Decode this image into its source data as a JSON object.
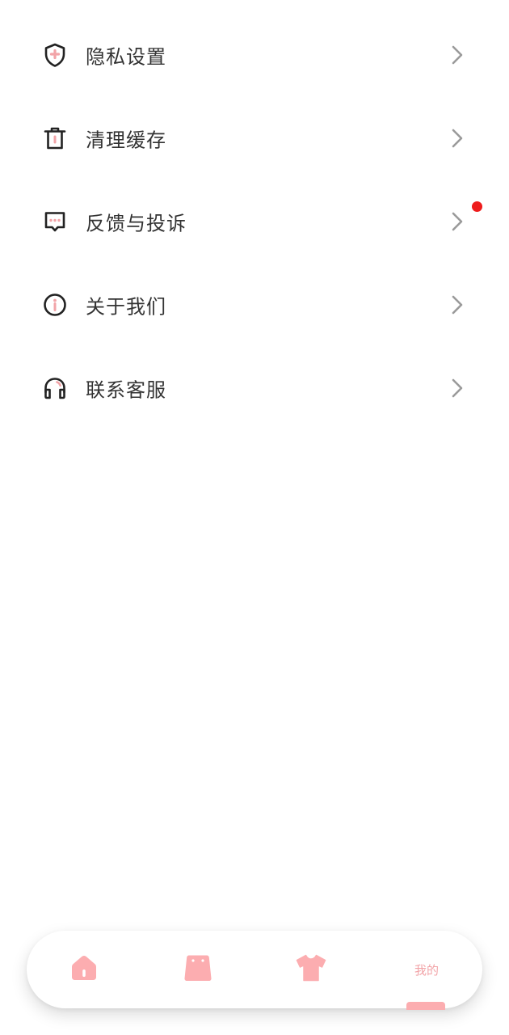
{
  "colors": {
    "accent": "#fcadb0",
    "accent_text": "#f2a4a8",
    "notification_dot": "#ee1c1c",
    "text": "#333333",
    "icon": "#222222",
    "chevron": "#9a9a9a"
  },
  "menu": {
    "items": [
      {
        "label": "隐私设置",
        "icon": "shield-icon"
      },
      {
        "label": "清理缓存",
        "icon": "trash-icon"
      },
      {
        "label": "反馈与投诉",
        "icon": "message-icon",
        "has_notification": true
      },
      {
        "label": "关于我们",
        "icon": "info-icon"
      },
      {
        "label": "联系客服",
        "icon": "headphones-icon"
      }
    ]
  },
  "tabbar": {
    "tabs": [
      {
        "icon": "home-icon"
      },
      {
        "icon": "shopping-bag-icon"
      },
      {
        "icon": "shirt-icon"
      },
      {
        "label": "我的",
        "active": true
      }
    ]
  }
}
